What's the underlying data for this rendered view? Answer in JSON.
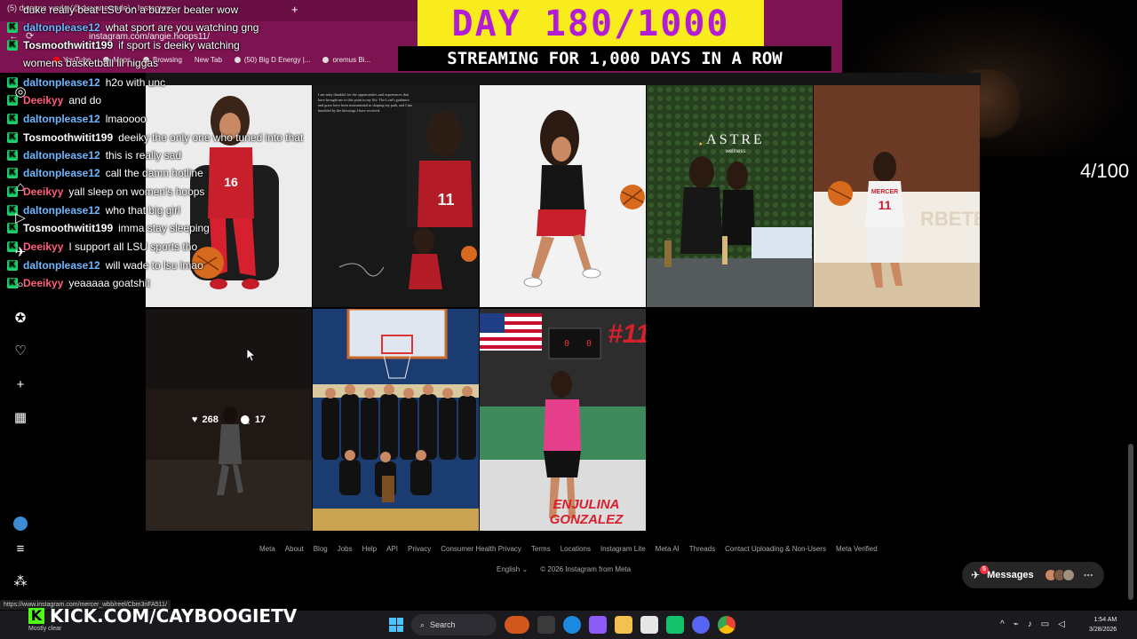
{
  "browser": {
    "tab_title": "(5) dwayne wade (@dwyanewade) • Instagram",
    "tab_new": "+",
    "address": "instagram.com/angie.hoops11/",
    "bookmarks": [
      "YouTube",
      "Maps",
      "Browsing",
      "New Tab",
      "(50) Big D Energy |...",
      "oremus Bi..."
    ]
  },
  "overlay": {
    "day_banner": "DAY 180/1000",
    "stream_subtitle": "STREAMING FOR 1,000 DAYS IN A ROW",
    "counter": "4/100",
    "kick_url": "KICK.COM/CAYBOOGIETV",
    "status_url": "https://www.instagram.com/mercer_wbb/reel/Cbm3nFA511/",
    "weather": "Mostly clear"
  },
  "chat": [
    {
      "user": "",
      "msg": "duke really beat LSU on a buzzer beater wow",
      "color": "#ffffff"
    },
    {
      "user": "daltonplease12",
      "msg": "what sport are you watching gng",
      "color": "#6fb7ff"
    },
    {
      "user": "Tosmoothwitit199",
      "msg": "if sport is deeiky watching",
      "color": "#ffffff"
    },
    {
      "user": "",
      "msg": "womens basketball lil niggas",
      "color": "#ffffff"
    },
    {
      "user": "daltonplease12",
      "msg": "h2o with unc",
      "color": "#6fb7ff"
    },
    {
      "user": "Deeikyy",
      "msg": "and do",
      "color": "#ff5d7a"
    },
    {
      "user": "daltonplease12",
      "msg": "lmaoooo",
      "color": "#6fb7ff"
    },
    {
      "user": "Tosmoothwitit199",
      "msg": "deeiky the only one who tuned into that",
      "color": "#ffffff"
    },
    {
      "user": "daltonplease12",
      "msg": "this is really sad",
      "color": "#6fb7ff"
    },
    {
      "user": "daltonplease12",
      "msg": "call the damn hotline",
      "color": "#6fb7ff"
    },
    {
      "user": "Deeikyy",
      "msg": "yall sleep on women's hoops",
      "color": "#ff5d7a"
    },
    {
      "user": "daltonplease12",
      "msg": "who that big girl",
      "color": "#6fb7ff"
    },
    {
      "user": "Tosmoothwitit199",
      "msg": "imma stay sleeping",
      "color": "#ffffff"
    },
    {
      "user": "Deeikyy",
      "msg": "I support all LSU sports tho",
      "color": "#ff5d7a"
    },
    {
      "user": "daltonplease12",
      "msg": "will wade to lsu lmao",
      "color": "#6fb7ff"
    },
    {
      "user": "Deeikyy",
      "msg": "yeaaaaa goatshit",
      "color": "#ff5d7a"
    }
  ],
  "hovered_post": {
    "likes": "268",
    "comments": "17"
  },
  "tile_text": {
    "letter_heading": "I am truly thankful for the opportunities and experiences that have brought me to this point in my life. The Lord's guidance and grace have been instrumental in shaping my path, and I am humbled by the blessings I have received.",
    "astre_sign": "ASTRE",
    "astre_sub": "wellness",
    "jersey_number": "#11",
    "player_name_line1": "ENJULINA",
    "player_name_line2": "GONZALEZ",
    "jersey_team": "MERCER",
    "jersey_digits": "11",
    "jersey_16": "16"
  },
  "footer": {
    "links": [
      "Meta",
      "About",
      "Blog",
      "Jobs",
      "Help",
      "API",
      "Privacy",
      "Consumer Health Privacy",
      "Terms",
      "Locations",
      "Instagram Lite",
      "Meta AI",
      "Threads",
      "Contact Uploading & Non-Users",
      "Meta Verified"
    ],
    "language": "English",
    "copyright": "© 2026 Instagram from Meta"
  },
  "messages": {
    "label": "Messages",
    "badge": "5"
  },
  "taskbar": {
    "search": "Search",
    "time": "1:54 AM",
    "date": "3/28/2026"
  }
}
